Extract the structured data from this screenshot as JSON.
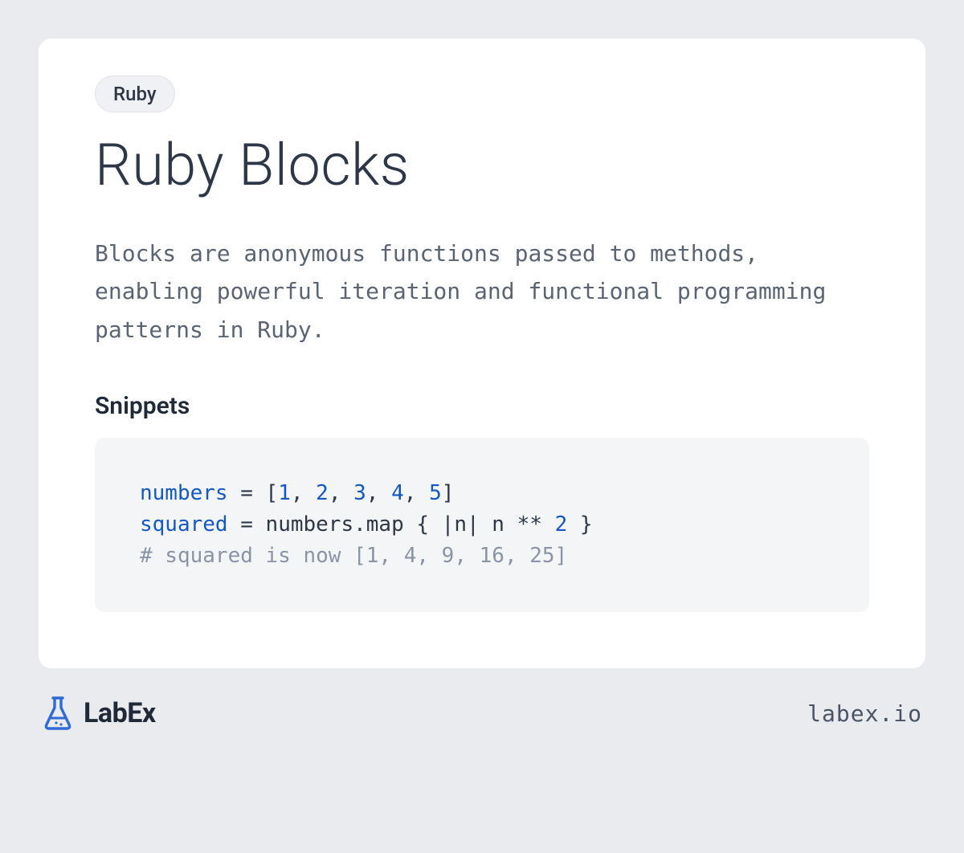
{
  "tag": "Ruby",
  "title": "Ruby Blocks",
  "description": "Blocks are anonymous functions passed to methods, enabling powerful iteration and functional programming patterns in Ruby.",
  "section_heading": "Snippets",
  "code": {
    "line1": {
      "id": "numbers",
      "eq": " = [",
      "n1": "1",
      "c1": ", ",
      "n2": "2",
      "c2": ", ",
      "n3": "3",
      "c3": ", ",
      "n4": "4",
      "c4": ", ",
      "n5": "5",
      "end": "]"
    },
    "line2": {
      "id": "squared",
      "mid": " = numbers.map { |n| n ** ",
      "n": "2",
      "end": " }"
    },
    "line3": {
      "cmt": "# squared is now [1, 4, 9, 16, 25]"
    }
  },
  "brand": {
    "name": "LabEx",
    "site": "labex.io"
  }
}
